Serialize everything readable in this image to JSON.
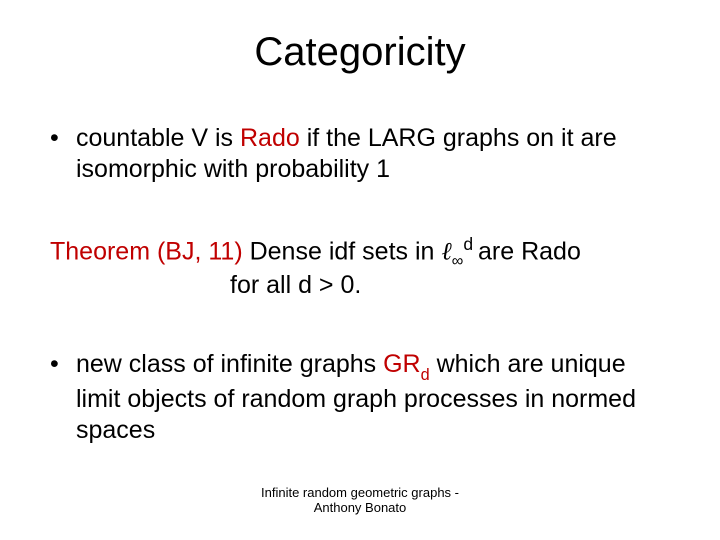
{
  "title": "Categoricity",
  "bullets": {
    "b1_pre": "countable V is ",
    "b1_red": "Rado",
    "b1_post": " if the LARG graphs on it are isomorphic with probability 1",
    "b3_pre": "new class of infinite graphs ",
    "b3_red": "GR",
    "b3_red_sub": "d",
    "b3_post": " which are unique limit objects of random graph processes in normed spaces"
  },
  "theorem": {
    "label_red": "Theorem (BJ, 11)",
    "mid1": " Dense idf sets in ",
    "ell": "ℓ",
    "sub": "∞",
    "sup": "d ",
    "mid2": " are Rado",
    "line2": "for all d > 0."
  },
  "footer": {
    "line1": "Infinite random geometric graphs -",
    "line2": "Anthony Bonato"
  }
}
